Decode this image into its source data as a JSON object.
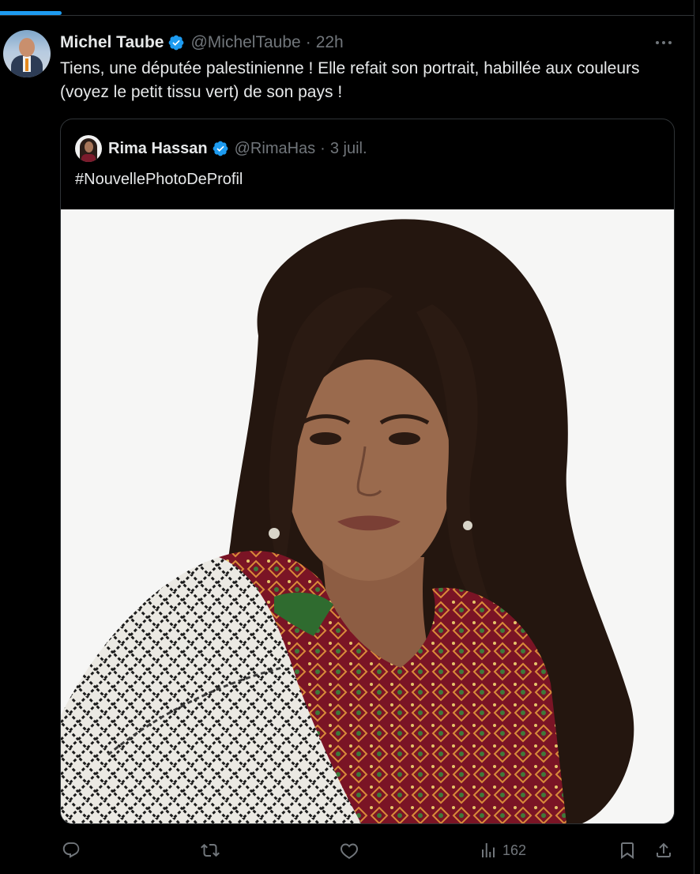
{
  "tweet": {
    "author": {
      "name": "Michel Taube",
      "handle": "@MichelTaube",
      "verified": true
    },
    "separator": "·",
    "time": "22h",
    "text": "Tiens, une députée palestinienne ! Elle refait son portrait, habillée aux couleurs (voyez le petit tissu vert) de son pays !",
    "more_icon": "more-horizontal-icon"
  },
  "quoted_tweet": {
    "author": {
      "name": "Rima Hassan",
      "handle": "@RimaHas",
      "verified": true
    },
    "separator": "·",
    "time": "3 juil.",
    "text": "#NouvellePhotoDeProfil",
    "media": {
      "type": "photo"
    }
  },
  "actions": {
    "reply": {
      "icon": "reply-icon",
      "count": ""
    },
    "retweet": {
      "icon": "retweet-icon",
      "count": ""
    },
    "like": {
      "icon": "like-icon",
      "count": ""
    },
    "views": {
      "icon": "views-icon",
      "count": "162"
    },
    "bookmark": {
      "icon": "bookmark-icon"
    },
    "share": {
      "icon": "share-icon"
    }
  },
  "colors": {
    "background": "#000000",
    "text": "#e7e9ea",
    "muted": "#71767b",
    "accent": "#1d9bf0",
    "border": "#2f3336"
  }
}
